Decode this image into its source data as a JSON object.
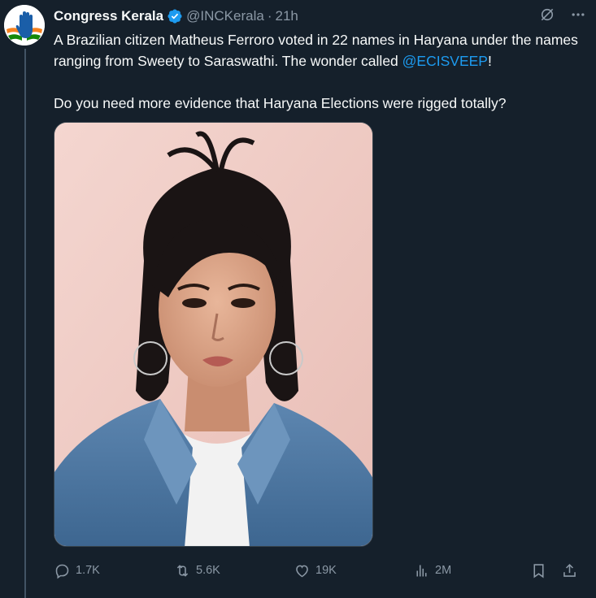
{
  "author": {
    "display_name": "Congress Kerala",
    "handle": "@INCKerala",
    "separator": "·",
    "time": "21h"
  },
  "tweet": {
    "line1_pre": "A Brazilian citizen Matheus Ferroro voted in 22 names in Haryana under the names ranging from Sweety to Saraswathi. The wonder called ",
    "mention": "@ECISVEEP",
    "line1_post": "!",
    "line2": "Do you need more evidence that Haryana Elections were rigged totally?"
  },
  "stats": {
    "replies": "1.7K",
    "reposts": "5.6K",
    "likes": "19K",
    "views": "2M"
  },
  "icons": {
    "verified": "verified-badge-icon",
    "grok": "grok-icon",
    "more": "more-icon",
    "reply": "reply-icon",
    "repost": "repost-icon",
    "like": "like-icon",
    "views": "views-icon",
    "bookmark": "bookmark-icon",
    "share": "share-icon"
  },
  "colors": {
    "background": "#15202b",
    "accent": "#1d9bf0",
    "muted": "#8b98a5",
    "text": "#f7f9f9"
  }
}
